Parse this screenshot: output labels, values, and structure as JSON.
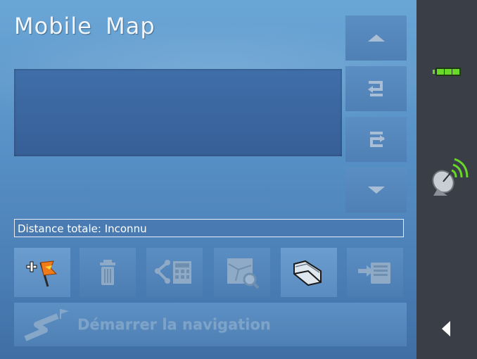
{
  "app": {
    "title": "Mobile Map"
  },
  "route": {
    "distance_text": "Distance totale: Inconnu"
  },
  "side_buttons": [
    {
      "icon": "arrow-up-icon"
    },
    {
      "icon": "rotate-left-icon"
    },
    {
      "icon": "rotate-right-icon"
    },
    {
      "icon": "arrow-down-icon"
    }
  ],
  "toolbar": [
    {
      "icon": "add-waypoint-flag-icon",
      "active": true
    },
    {
      "icon": "trash-icon",
      "active": false
    },
    {
      "icon": "route-calculator-icon",
      "active": false
    },
    {
      "icon": "map-search-icon",
      "active": false
    },
    {
      "icon": "folder-icon",
      "active": true
    },
    {
      "icon": "export-route-icon",
      "active": false
    }
  ],
  "navigation": {
    "start_label": "Démarrer la navigation"
  },
  "status_bar": {
    "battery_icon": "battery-icon",
    "gps_icon": "gps-satellite-icon",
    "back_icon": "back-arrow-icon"
  },
  "colors": {
    "panel": "#5791c6",
    "status_bar": "#3a3e46",
    "battery": "#6ad82a",
    "disabled_text": "#7ea3c9"
  }
}
